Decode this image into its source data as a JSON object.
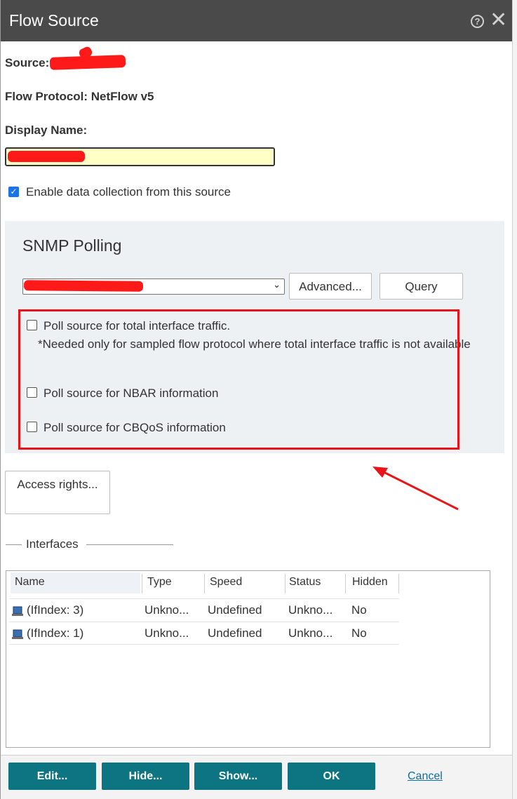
{
  "window": {
    "title": "Flow Source",
    "help_icon": "?",
    "close_icon": "✕"
  },
  "fields": {
    "source_label": "Source:",
    "protocol_label": "Flow Protocol: NetFlow v5",
    "display_name_label": "Display Name:",
    "display_name_value": "",
    "enable_collection_label": "Enable data collection from this source",
    "enable_collection_checked": true
  },
  "snmp": {
    "title": "SNMP Polling",
    "selected_value": "",
    "advanced_button": "Advanced...",
    "query_button": "Query",
    "poll_total_traffic_label": "Poll source for total interface traffic.",
    "poll_total_traffic_note": "*Needed only for sampled flow protocol where total interface traffic is not available",
    "poll_nbar_label": "Poll source for NBAR information",
    "poll_cbqos_label": "Poll source for CBQoS information"
  },
  "access_rights_button": "Access rights...",
  "interfaces": {
    "section_title": "Interfaces",
    "columns": [
      "Name",
      "Type",
      "Speed",
      "Status",
      "Hidden"
    ],
    "rows": [
      {
        "name": "(IfIndex: 3)",
        "type": "Unkno...",
        "speed": "Undefined",
        "status": "Unkno...",
        "hidden": "No"
      },
      {
        "name": "(IfIndex: 1)",
        "type": "Unkno...",
        "speed": "Undefined",
        "status": "Unkno...",
        "hidden": "No"
      }
    ]
  },
  "footer": {
    "edit_button": "Edit...",
    "hide_button": "Hide...",
    "show_button": "Show...",
    "ok_button": "OK",
    "cancel_link": "Cancel"
  },
  "colors": {
    "titlebar": "#4a4a4a",
    "accent_teal": "#0d7481",
    "highlight_red": "#e8141a",
    "input_yellow": "#ffffc6"
  }
}
